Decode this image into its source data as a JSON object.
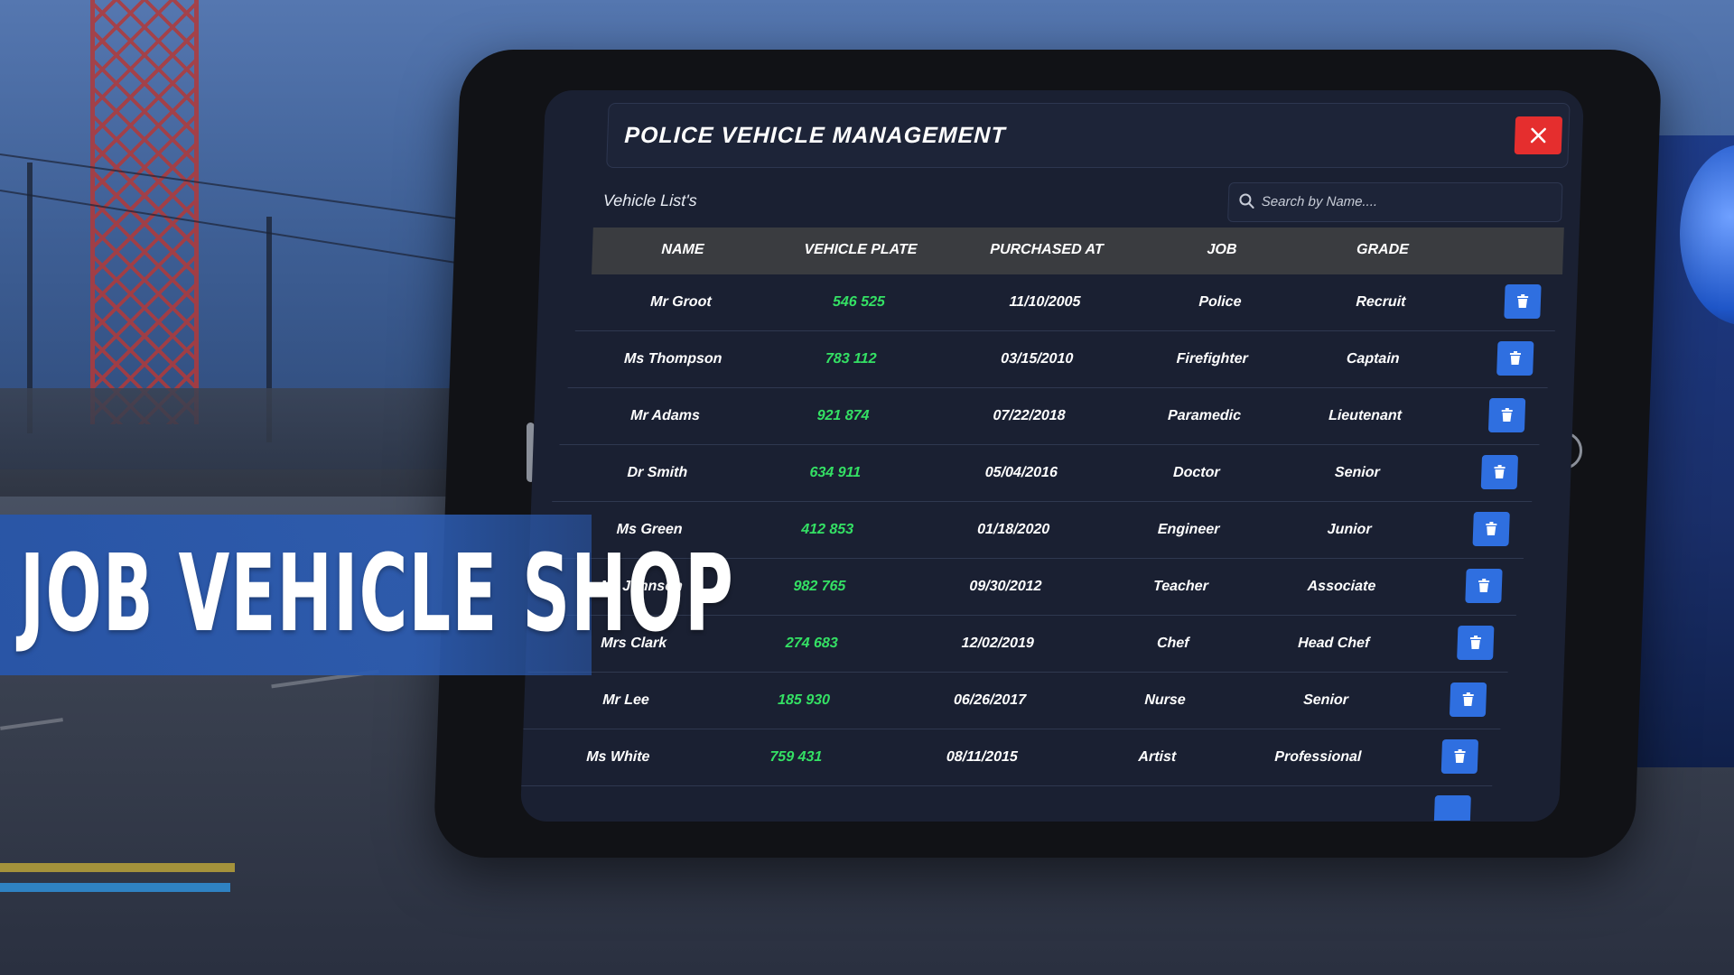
{
  "banner": {
    "title": "JOB VEHICLE SHOP"
  },
  "window": {
    "title": "POLICE VEHICLE MANAGEMENT"
  },
  "list": {
    "label": "Vehicle List's"
  },
  "search": {
    "placeholder": "Search by Name...."
  },
  "table": {
    "headers": [
      "NAME",
      "VEHICLE PLATE",
      "PURCHASED AT",
      "JOB",
      "GRADE"
    ],
    "rows": [
      {
        "name": "Mr Groot",
        "plate": "546 525",
        "purchased": "11/10/2005",
        "job": "Police",
        "grade": "Recruit"
      },
      {
        "name": "Ms Thompson",
        "plate": "783 112",
        "purchased": "03/15/2010",
        "job": "Firefighter",
        "grade": "Captain"
      },
      {
        "name": "Mr Adams",
        "plate": "921 874",
        "purchased": "07/22/2018",
        "job": "Paramedic",
        "grade": "Lieutenant"
      },
      {
        "name": "Dr Smith",
        "plate": "634 911",
        "purchased": "05/04/2016",
        "job": "Doctor",
        "grade": "Senior"
      },
      {
        "name": "Ms Green",
        "plate": "412 853",
        "purchased": "01/18/2020",
        "job": "Engineer",
        "grade": "Junior"
      },
      {
        "name": "Mr Johnson",
        "plate": "982 765",
        "purchased": "09/30/2012",
        "job": "Teacher",
        "grade": "Associate"
      },
      {
        "name": "Mrs Clark",
        "plate": "274 683",
        "purchased": "12/02/2019",
        "job": "Chef",
        "grade": "Head Chef"
      },
      {
        "name": "Mr Lee",
        "plate": "185 930",
        "purchased": "06/26/2017",
        "job": "Nurse",
        "grade": "Senior"
      },
      {
        "name": "Ms White",
        "plate": "759 431",
        "purchased": "08/11/2015",
        "job": "Artist",
        "grade": "Professional"
      }
    ]
  },
  "icons": {
    "close": "close-icon",
    "delete": "trash-icon",
    "search": "search-icon"
  },
  "colors": {
    "plate": "#34e064",
    "close": "#e52e2e",
    "delete": "#2f6fe0",
    "banner": "#2c5cb2"
  }
}
